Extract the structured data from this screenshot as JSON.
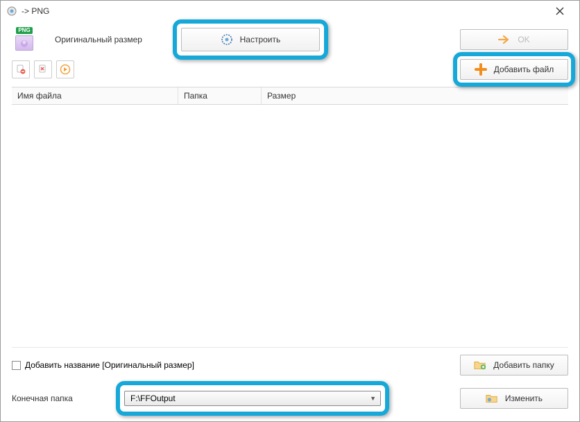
{
  "window": {
    "title": "  -> PNG"
  },
  "format": {
    "badge": "PNG",
    "label": "Оригинальный размер"
  },
  "toolbar": {
    "configure_label": "Настроить",
    "ok_label": "OK",
    "addfile_label": "Добавить файл"
  },
  "columns": {
    "filename": "Имя файла",
    "folder": "Папка",
    "size": "Размер"
  },
  "bottom": {
    "addname_label": "Добавить название [Оригинальный размер]",
    "addfolder_label": "Добавить папку",
    "output_label": "Конечная папка",
    "output_value": "F:\\FFOutput",
    "change_label": "Изменить"
  }
}
